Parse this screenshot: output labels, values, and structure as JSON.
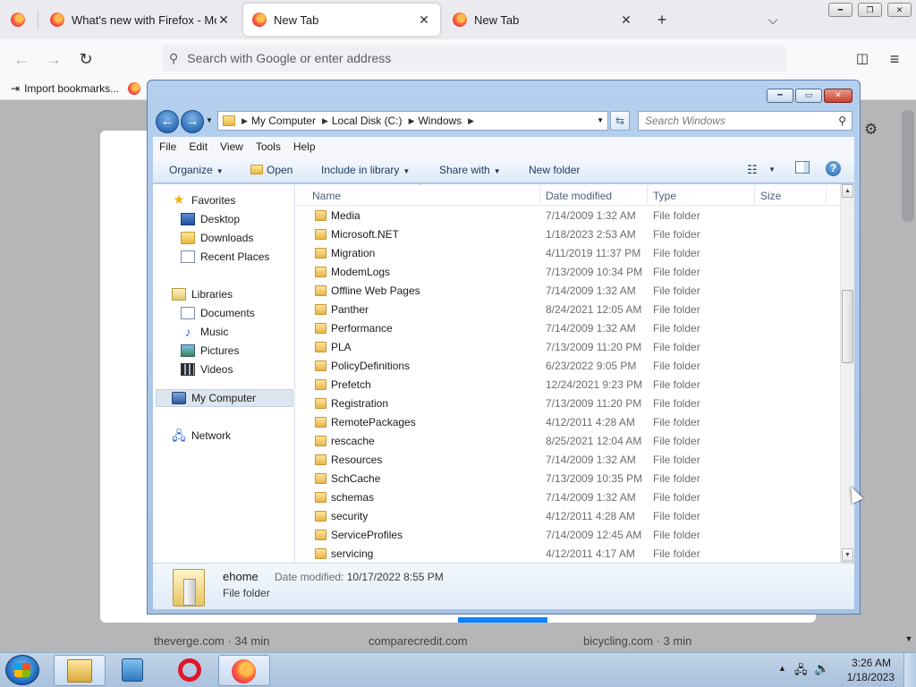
{
  "browser": {
    "tabs": [
      {
        "title": "What's new with Firefox - More",
        "active": false
      },
      {
        "title": "New Tab",
        "active": true
      },
      {
        "title": "New Tab",
        "active": false
      }
    ],
    "url_placeholder": "Search with Google or enter address",
    "bookmarks": {
      "import_label": "Import bookmarks..."
    },
    "top_sites": [
      {
        "label": "theverge.com · 34 min"
      },
      {
        "label": "comparecredit.com"
      },
      {
        "label": "bicycling.com · 3 min"
      }
    ]
  },
  "explorer": {
    "breadcrumb": [
      "My Computer",
      "Local Disk (C:)",
      "Windows"
    ],
    "search_placeholder": "Search Windows",
    "menu": [
      "File",
      "Edit",
      "View",
      "Tools",
      "Help"
    ],
    "commands": {
      "organize": "Organize",
      "open": "Open",
      "include_in_library": "Include in library",
      "share_with": "Share with",
      "new_folder": "New folder"
    },
    "nav": {
      "favorites": "Favorites",
      "desktop": "Desktop",
      "downloads": "Downloads",
      "recent_places": "Recent Places",
      "libraries": "Libraries",
      "documents": "Documents",
      "music": "Music",
      "pictures": "Pictures",
      "videos": "Videos",
      "my_computer": "My Computer",
      "network": "Network"
    },
    "columns": {
      "name": "Name",
      "date_modified": "Date modified",
      "type": "Type",
      "size": "Size"
    },
    "files": [
      {
        "name": "Media",
        "date": "7/14/2009 1:32 AM",
        "type": "File folder"
      },
      {
        "name": "Microsoft.NET",
        "date": "1/18/2023 2:53 AM",
        "type": "File folder"
      },
      {
        "name": "Migration",
        "date": "4/11/2019 11:37 PM",
        "type": "File folder"
      },
      {
        "name": "ModemLogs",
        "date": "7/13/2009 10:34 PM",
        "type": "File folder"
      },
      {
        "name": "Offline Web Pages",
        "date": "7/14/2009 1:32 AM",
        "type": "File folder"
      },
      {
        "name": "Panther",
        "date": "8/24/2021 12:05 AM",
        "type": "File folder"
      },
      {
        "name": "Performance",
        "date": "7/14/2009 1:32 AM",
        "type": "File folder"
      },
      {
        "name": "PLA",
        "date": "7/13/2009 11:20 PM",
        "type": "File folder"
      },
      {
        "name": "PolicyDefinitions",
        "date": "6/23/2022 9:05 PM",
        "type": "File folder"
      },
      {
        "name": "Prefetch",
        "date": "12/24/2021 9:23 PM",
        "type": "File folder"
      },
      {
        "name": "Registration",
        "date": "7/13/2009 11:20 PM",
        "type": "File folder"
      },
      {
        "name": "RemotePackages",
        "date": "4/12/2011 4:28 AM",
        "type": "File folder"
      },
      {
        "name": "rescache",
        "date": "8/25/2021 12:04 AM",
        "type": "File folder"
      },
      {
        "name": "Resources",
        "date": "7/14/2009 1:32 AM",
        "type": "File folder"
      },
      {
        "name": "SchCache",
        "date": "7/13/2009 10:35 PM",
        "type": "File folder"
      },
      {
        "name": "schemas",
        "date": "7/14/2009 1:32 AM",
        "type": "File folder"
      },
      {
        "name": "security",
        "date": "4/12/2011 4:28 AM",
        "type": "File folder"
      },
      {
        "name": "ServiceProfiles",
        "date": "7/14/2009 12:45 AM",
        "type": "File folder"
      },
      {
        "name": "servicing",
        "date": "4/12/2011 4:17 AM",
        "type": "File folder"
      }
    ],
    "details": {
      "name": "ehome",
      "type": "File folder",
      "modified_label": "Date modified:",
      "modified_value": "10/17/2022 8:55 PM"
    }
  },
  "taskbar": {
    "time": "3:26 AM",
    "date": "1/18/2023"
  }
}
